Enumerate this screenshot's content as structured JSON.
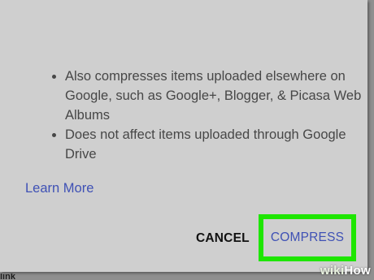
{
  "dialog": {
    "bullets": [
      "Also compresses items uploaded elsewhere on Google, such as Google+, Blogger, & Picasa Web Albums",
      "Does not affect items uploaded through Google Drive"
    ],
    "learn_more_label": "Learn More",
    "cancel_label": "CANCEL",
    "compress_label": "COMPRESS"
  },
  "background": {
    "partial_text": "link"
  },
  "watermark": {
    "wiki": "wiki",
    "how": "How"
  },
  "colors": {
    "link_accent": "#3f51b5",
    "highlight": "#1ee600"
  }
}
